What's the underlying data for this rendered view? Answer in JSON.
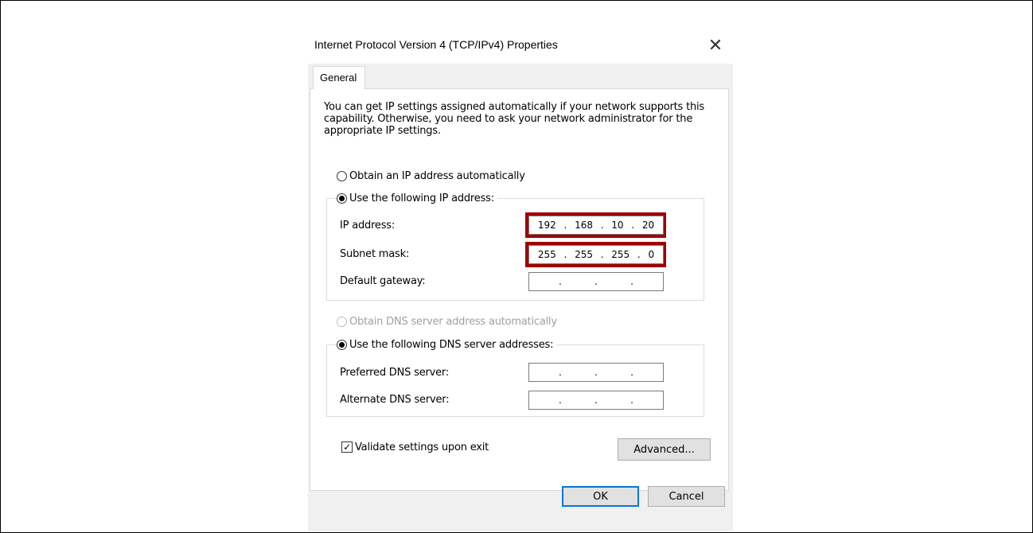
{
  "dialog": {
    "title": "Internet Protocol Version 4 (TCP/IPv4) Properties",
    "close_glyph": "✕",
    "tab_label": "General",
    "intro_text": "You can get IP settings assigned automatically if your network supports this capability. Otherwise, you need to ask your network administrator for the appropriate IP settings."
  },
  "ip_section": {
    "obtain_auto_label": "Obtain an IP address automatically",
    "obtain_auto_checked": false,
    "use_following_label": "Use the following IP address:",
    "use_following_checked": true,
    "fields": [
      {
        "label": "IP address:",
        "octets": [
          "192",
          "168",
          "10",
          "20"
        ],
        "highlighted": true
      },
      {
        "label": "Subnet mask:",
        "octets": [
          "255",
          "255",
          "255",
          "0"
        ],
        "highlighted": true
      },
      {
        "label": "Default gateway:",
        "octets": [
          "",
          "",
          "",
          ""
        ],
        "highlighted": false
      }
    ]
  },
  "dns_section": {
    "obtain_auto_label": "Obtain DNS server address automatically",
    "obtain_auto_enabled": false,
    "use_following_label": "Use the following DNS server addresses:",
    "use_following_checked": true,
    "fields": [
      {
        "label": "Preferred DNS server:",
        "octets": [
          "",
          "",
          "",
          ""
        ]
      },
      {
        "label": "Alternate DNS server:",
        "octets": [
          "",
          "",
          "",
          ""
        ]
      }
    ]
  },
  "validate_label": "Validate settings upon exit",
  "validate_checked": true,
  "buttons": {
    "advanced": "Advanced...",
    "ok": "OK",
    "cancel": "Cancel"
  },
  "colors": {
    "highlight": "#a00000",
    "default_button_border": "#0078d7"
  }
}
